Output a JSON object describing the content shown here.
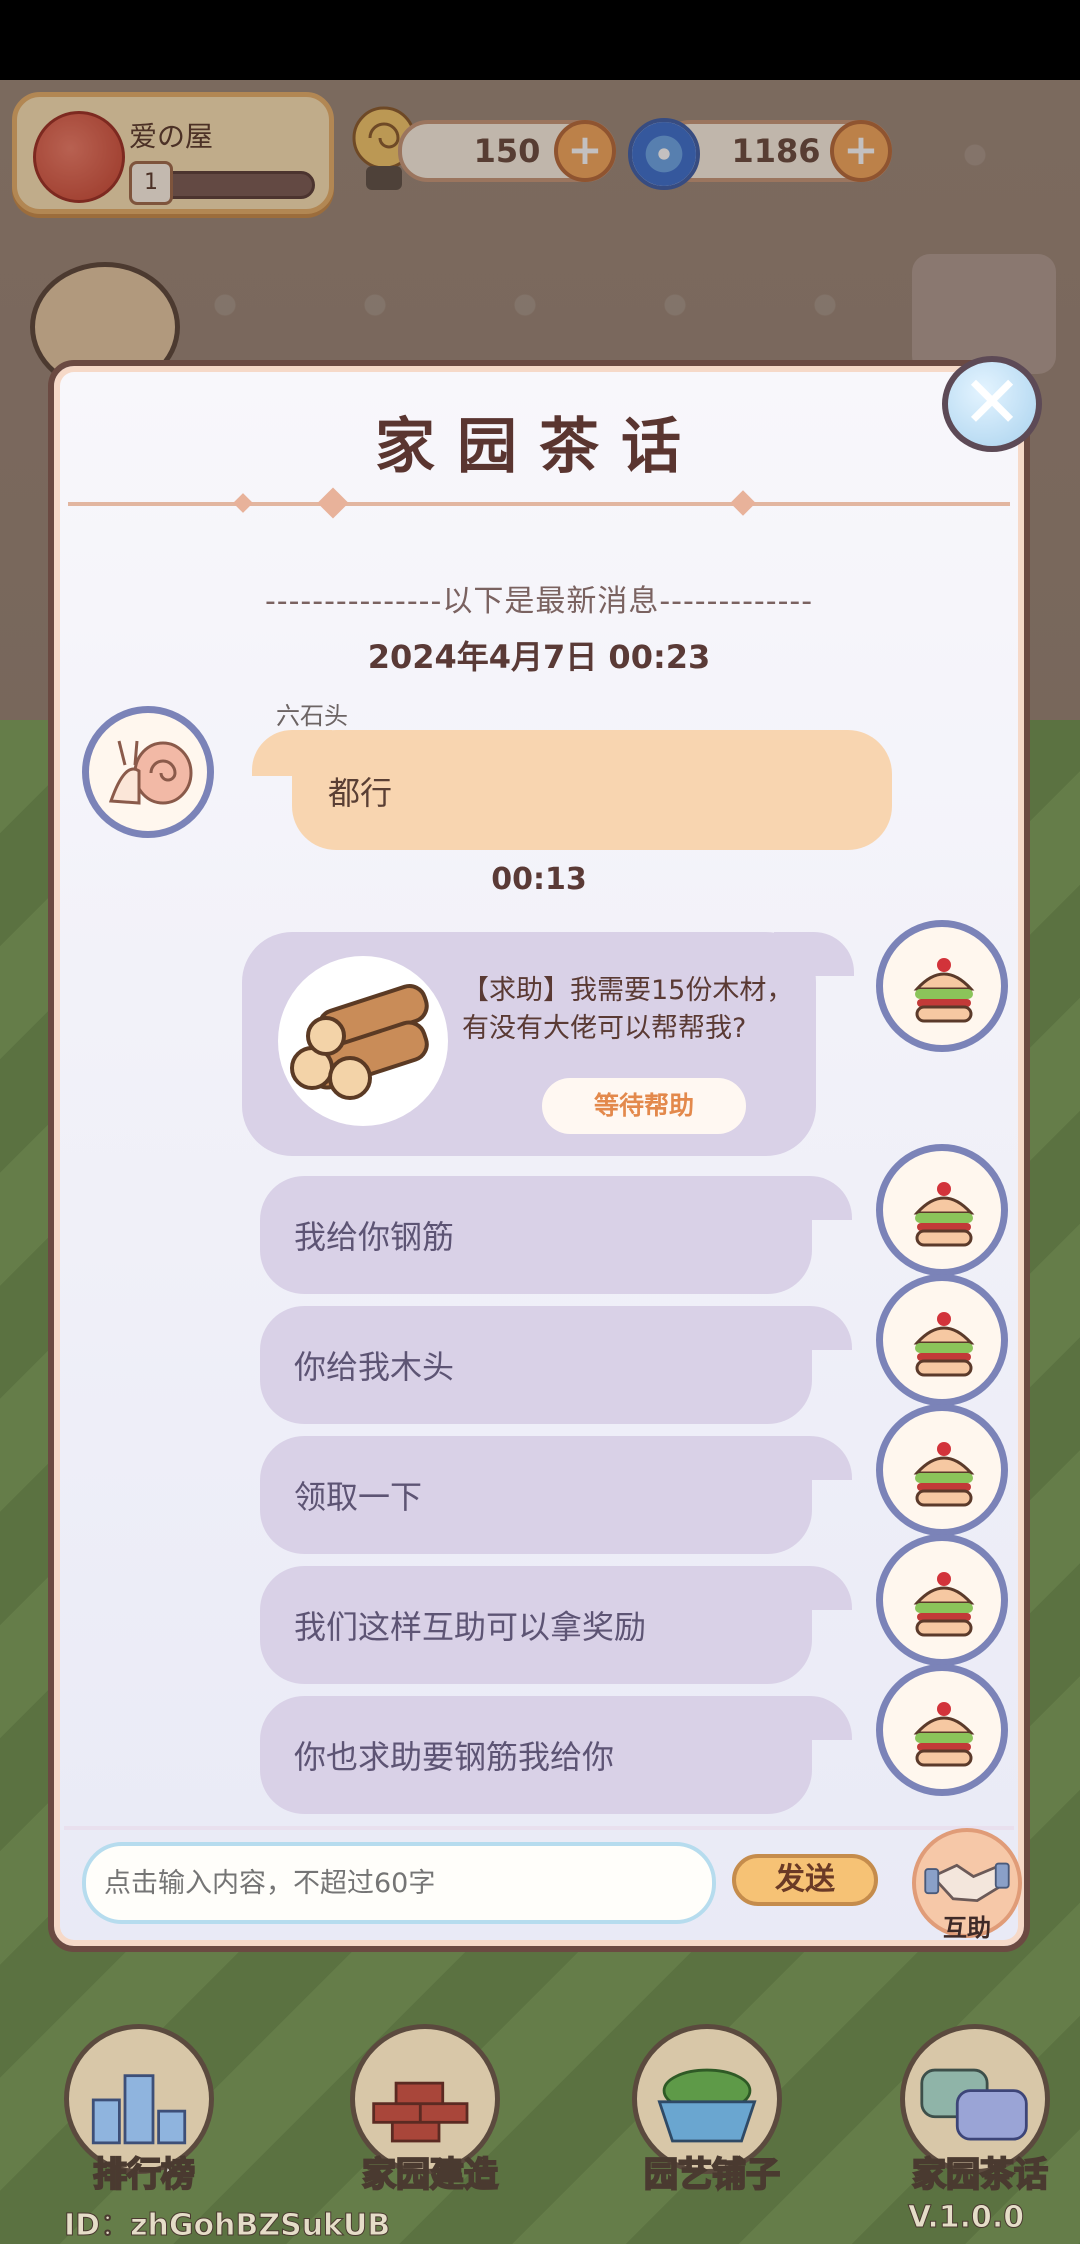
{
  "hud": {
    "home_name": "爱の屋",
    "home_level": "1",
    "snail_currency": "150",
    "spiral_currency": "1186"
  },
  "modal": {
    "title": "家园茶话",
    "divider_text": "---------------以下是最新消息-------------",
    "date": "2024年4月7日  00:23",
    "time_marker": "00:13"
  },
  "messages": {
    "incoming": {
      "sender": "六石头",
      "text": "都行"
    },
    "help_request": {
      "text": "【求助】我需要15份木材，有没有大佬可以帮帮我?",
      "button": "等待帮助"
    },
    "outgoing": [
      "我给你钢筋",
      "你给我木头",
      "领取一下",
      "我们这样互助可以拿奖励",
      "你也求助要钢筋我给你"
    ]
  },
  "composer": {
    "placeholder": "点击输入内容，不超过60字",
    "send_label": "发送",
    "mutual_label": "互助"
  },
  "nav": {
    "items": [
      "排行榜",
      "家园建造",
      "园艺铺子",
      "家园茶话"
    ]
  },
  "footer": {
    "id": "ID：zhGohBZSukUB",
    "version": "V.1.0.0"
  },
  "colors": {
    "modal_border": "#6b4a42",
    "incoming_bubble": "#f8d5b0",
    "outgoing_bubble": "#d9d1e7",
    "accent_orange": "#f6a85a"
  }
}
